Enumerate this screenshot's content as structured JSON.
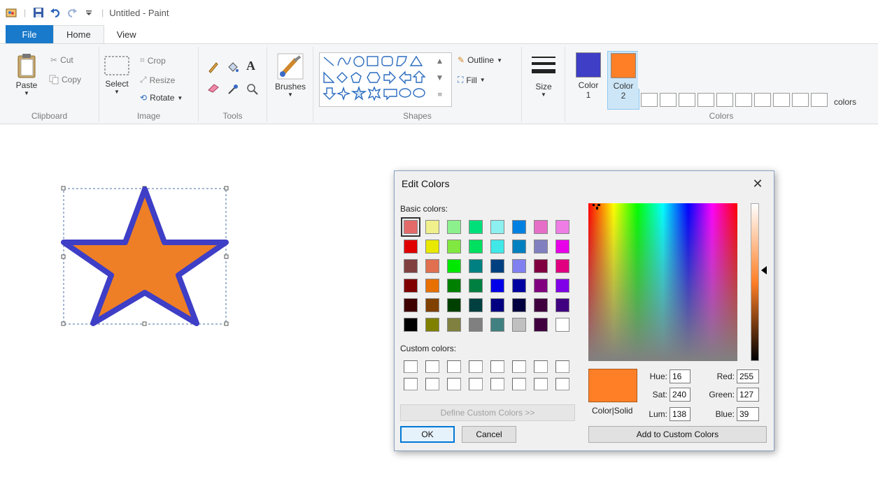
{
  "window": {
    "title": "Untitled - Paint"
  },
  "tabs": {
    "file": "File",
    "home": "Home",
    "view": "View"
  },
  "ribbon": {
    "clipboard": {
      "paste": "Paste",
      "cut": "Cut",
      "copy": "Copy",
      "label": "Clipboard"
    },
    "image": {
      "select": "Select",
      "crop": "Crop",
      "resize": "Resize",
      "rotate": "Rotate",
      "label": "Image"
    },
    "tools": {
      "label": "Tools"
    },
    "brushes": {
      "label": "Brushes"
    },
    "shapes": {
      "outline": "Outline",
      "fill": "Fill",
      "label": "Shapes"
    },
    "size": {
      "label": "Size"
    },
    "colors": {
      "color1": "Color",
      "color1_num": "1",
      "color2": "Color",
      "color2_num": "2",
      "edit_suffix": "colors",
      "label": "Colors",
      "color1_value": "#3e3ec6",
      "color2_value": "#ff7f27"
    }
  },
  "dialog": {
    "title": "Edit Colors",
    "basic_colors_label": "Basic colors:",
    "custom_colors_label": "Custom colors:",
    "define_custom": "Define Custom Colors >>",
    "ok": "OK",
    "cancel": "Cancel",
    "add_custom": "Add to Custom Colors",
    "color_solid": "Color|Solid",
    "hue_label": "Hue:",
    "hue": "16",
    "sat_label": "Sat:",
    "sat": "240",
    "lum_label": "Lum:",
    "lum": "138",
    "red_label": "Red:",
    "red": "255",
    "green_label": "Green:",
    "green": "127",
    "blue_label": "Blue:",
    "blue": "39",
    "basic_colors": [
      "#e46a6a",
      "#f0f08c",
      "#8cf08c",
      "#00e07a",
      "#8cf0f0",
      "#0080e0",
      "#e66ec8",
      "#ee7ee6",
      "#e00000",
      "#e8e800",
      "#80e840",
      "#00e060",
      "#40e8e8",
      "#0080c0",
      "#8080c0",
      "#e800e8",
      "#804040",
      "#e07050",
      "#00e800",
      "#008080",
      "#004080",
      "#8080f0",
      "#800040",
      "#e00080",
      "#800000",
      "#e87000",
      "#008000",
      "#008040",
      "#0000e8",
      "#0000a0",
      "#800080",
      "#8000e8",
      "#400000",
      "#804000",
      "#004000",
      "#004040",
      "#000080",
      "#000040",
      "#400040",
      "#400080",
      "#000000",
      "#808000",
      "#808040",
      "#808080",
      "#408080",
      "#c0c0c0",
      "#400040",
      "#ffffff"
    ]
  }
}
